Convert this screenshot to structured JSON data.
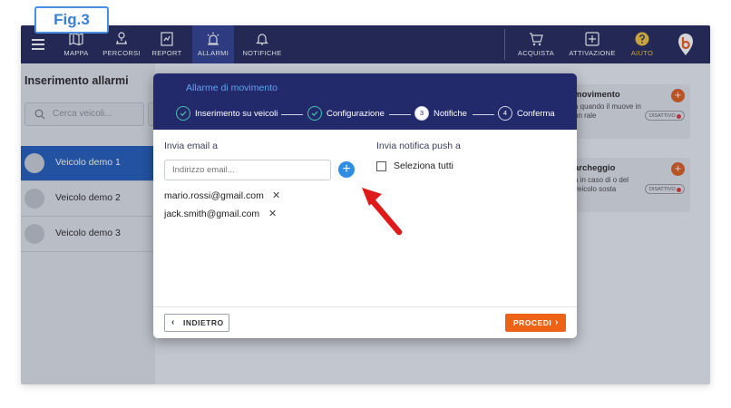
{
  "figure_label": "Fig.3",
  "nav": {
    "items": [
      {
        "label": "MAPPA",
        "icon": "map-icon"
      },
      {
        "label": "PERCORSI",
        "icon": "route-icon"
      },
      {
        "label": "REPORT",
        "icon": "report-icon"
      },
      {
        "label": "ALLARMI",
        "icon": "alarm-icon",
        "active": true
      },
      {
        "label": "NOTIFICHE",
        "icon": "bell-icon"
      }
    ],
    "right_items": [
      {
        "label": "ACQUISTA",
        "icon": "cart-icon"
      },
      {
        "label": "ATTIVAZIONE",
        "icon": "plus-box-icon"
      },
      {
        "label": "AIUTO",
        "icon": "help-icon"
      }
    ]
  },
  "left_panel": {
    "title": "Inserimento allarmi",
    "search_placeholder": "Cerca veicoli...",
    "vehicles": [
      "Veicolo demo 1",
      "Veicolo demo 2",
      "Veicolo demo 3"
    ]
  },
  "cards": [
    {
      "title": "movimento",
      "description": "a quando il muove in un rale",
      "status": "DISATTIVO"
    },
    {
      "title": "archeggio",
      "description": "a in caso di o del veicolo sosta",
      "status": "DISATTIVO"
    }
  ],
  "modal": {
    "title": "Allarme di movimento",
    "steps": [
      {
        "number": "",
        "label": "Inserimento su veicoli",
        "state": "done"
      },
      {
        "number": "",
        "label": "Configurazione",
        "state": "done"
      },
      {
        "number": "3",
        "label": "Notifiche",
        "state": "current"
      },
      {
        "number": "4",
        "label": "Conferma",
        "state": "pending"
      }
    ],
    "email_section_label": "Invia email a",
    "email_placeholder": "Indirizzo email...",
    "emails": [
      "mario.rossi@gmail.com",
      "jack.smith@gmail.com"
    ],
    "push_section_label": "Invia notifica push a",
    "select_all_label": "Seleziona tutti",
    "back_label": "INDIETRO",
    "next_label": "PROCEDI"
  },
  "colors": {
    "nav_bg": "#1d2355",
    "modal_header": "#232a6c",
    "accent_blue": "#2f8de4",
    "primary_orange": "#ee6216",
    "arrow_red": "#e0191b",
    "selected_vehicle": "#1c58b8"
  }
}
